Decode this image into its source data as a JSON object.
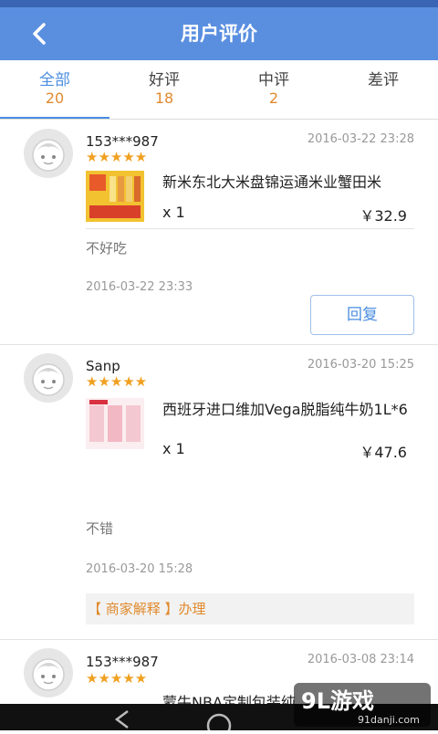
{
  "header": {
    "title": "用户评价",
    "back_icon": "chevron-left-icon"
  },
  "tabs": [
    {
      "label": "全部",
      "count": "20"
    },
    {
      "label": "好评",
      "count": "18"
    },
    {
      "label": "中评",
      "count": "2"
    },
    {
      "label": "差评",
      "count": ""
    }
  ],
  "reviews": [
    {
      "user": "153***987",
      "date": "2016-03-22 23:28",
      "stars": "★★★★★",
      "product": "新米东北大米盘锦运通米业蟹田米",
      "qty": "x 1",
      "price": "￥32.9",
      "comment": "不好吃",
      "comment_date": "2016-03-22 23:33",
      "reply_label": "回复"
    },
    {
      "user": "Sanp",
      "date": "2016-03-20 15:25",
      "stars": "★★★★★",
      "product": "西班牙进口维加Vega脱脂纯牛奶1L*6",
      "qty": "x 1",
      "price": "￥47.6",
      "comment": "不错",
      "comment_date": "2016-03-20 15:28",
      "merchant_reply": "【 商家解释 】办理"
    },
    {
      "user": "153***987",
      "date": "2016-03-08 23:14",
      "stars": "★★★★★",
      "product": "蒙牛NBA定制包装纯"
    }
  ],
  "watermark": {
    "brand": "9L游戏",
    "url": "91danji.com"
  },
  "colors": {
    "header": "#5a8fe0",
    "accent": "#4a8de0",
    "count": "#e08a2e",
    "star": "#f0a020"
  }
}
